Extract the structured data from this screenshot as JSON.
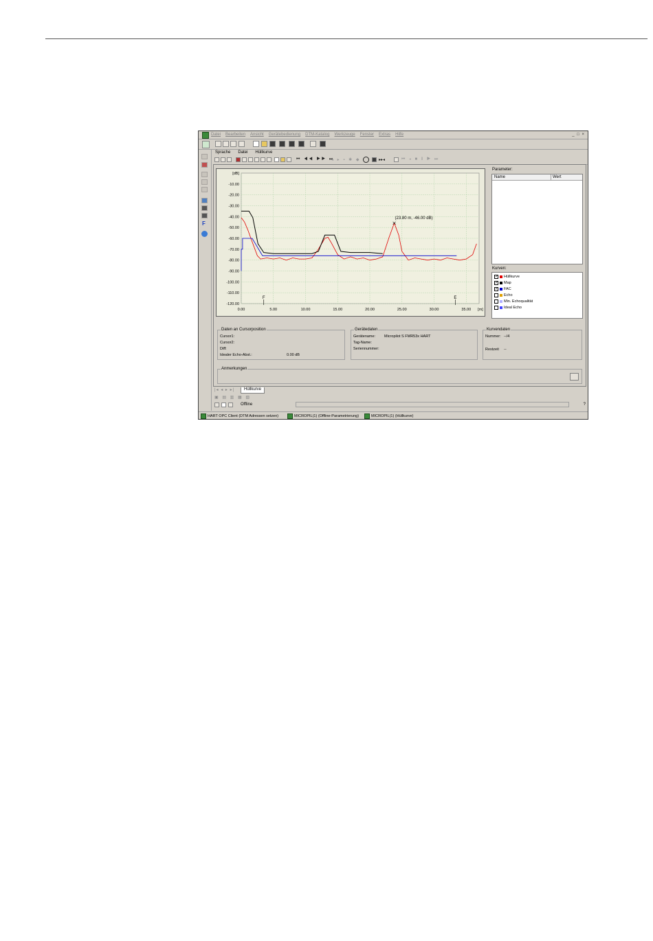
{
  "window": {
    "menu": [
      "Datei",
      "Bearbeiten",
      "Ansicht",
      "Gerätebedienung",
      "DTM-Katalog",
      "Werkzeuge",
      "Fenster",
      "Extras",
      "Hilfe"
    ],
    "controls": "_ □ ×"
  },
  "submenu": [
    "Sprache",
    "Datei",
    "Hüllkurve"
  ],
  "plot": {
    "help": "?"
  },
  "parameter": {
    "label": "Parameter:",
    "col_name": "Name",
    "col_value": "Wert"
  },
  "kurven": {
    "label": "Kurven:",
    "items": [
      {
        "label": "Hüllkurve",
        "checked": true,
        "color": "#e00000"
      },
      {
        "label": "Map",
        "checked": true,
        "color": "#000000"
      },
      {
        "label": "FAC",
        "checked": true,
        "color": "#0000cc"
      },
      {
        "label": "Echo",
        "checked": false,
        "color": "#e0a000"
      },
      {
        "label": "Min. Echoqualität",
        "checked": false,
        "color": "#b0b0ff"
      },
      {
        "label": "Ideal Echo",
        "checked": false,
        "color": "#4040ff"
      }
    ]
  },
  "cursor_group": {
    "title": "Daten an Cursorposition",
    "cursor1": "Cursor1:",
    "cursor2": "Cursor2:",
    "diff": "Diff:",
    "ideal_label": "Idealer Echo-Abst.:",
    "ideal_value": "0.00 dB"
  },
  "device_group": {
    "title": "Gerätedaten",
    "name_label": "Gerätename:",
    "name_value": "Micropilot S FMR53x HART",
    "tag_label": "Tag-Name:",
    "serial_label": "Seriennummer:"
  },
  "curve_group": {
    "title": "Kurvendaten",
    "number_label": "Nummer:",
    "number_value": "--/4",
    "rest_label": "Restzeit",
    "rest_value": "--"
  },
  "notes": {
    "title": "Anmerkungen"
  },
  "tab": {
    "label": "Hüllkurve"
  },
  "status": {
    "text": "Offline",
    "help": "?"
  },
  "taskbar": [
    "HART OPC Client (DTM Adressen setzen)",
    "MICROPIL(1) (Offline-Parametrierung)",
    "MICROPIL(1) (Hüllkurve)"
  ],
  "chart_data": {
    "type": "line",
    "ylabel": "[dB]",
    "xlabel": "[m]",
    "xlim": [
      0,
      37
    ],
    "ylim": [
      -120,
      0
    ],
    "xticks": [
      "0.00",
      "5.00",
      "10.00",
      "15.00",
      "20.00",
      "25.00",
      "30.00",
      "35.00"
    ],
    "yticks": [
      "-10.00",
      "-20.00",
      "-30.00",
      "-40.00",
      "-50.00",
      "-60.00",
      "-70.00",
      "-80.00",
      "-90.00",
      "-100.00",
      "-110.00",
      "-120.00"
    ],
    "grid": true,
    "markers": [
      {
        "label": "F",
        "x": 3.5
      },
      {
        "label": "E",
        "x": 33.3
      }
    ],
    "annotation": {
      "text": "(23.80 m, -46.00 dB)",
      "x": 23.8,
      "y": -46
    },
    "series": [
      {
        "name": "Hüllkurve",
        "color": "#e00000",
        "points": [
          [
            0,
            -41
          ],
          [
            0.5,
            -45
          ],
          [
            1,
            -52
          ],
          [
            1.5,
            -60
          ],
          [
            2,
            -68
          ],
          [
            2.5,
            -76
          ],
          [
            3,
            -79
          ],
          [
            4,
            -78
          ],
          [
            5,
            -79
          ],
          [
            6,
            -78
          ],
          [
            7,
            -80
          ],
          [
            8,
            -78
          ],
          [
            9,
            -79
          ],
          [
            10,
            -79
          ],
          [
            11,
            -78
          ],
          [
            12,
            -70
          ],
          [
            13,
            -60
          ],
          [
            13.5,
            -59
          ],
          [
            14,
            -64
          ],
          [
            15,
            -75
          ],
          [
            16,
            -79
          ],
          [
            17,
            -77
          ],
          [
            18,
            -79
          ],
          [
            19,
            -78
          ],
          [
            20,
            -80
          ],
          [
            21,
            -79
          ],
          [
            22,
            -77
          ],
          [
            23,
            -59
          ],
          [
            23.8,
            -46
          ],
          [
            24.5,
            -57
          ],
          [
            25,
            -72
          ],
          [
            26,
            -80
          ],
          [
            27,
            -78
          ],
          [
            28,
            -79
          ],
          [
            29,
            -80
          ],
          [
            30,
            -79
          ],
          [
            31,
            -80
          ],
          [
            32,
            -78
          ],
          [
            33,
            -79
          ],
          [
            34,
            -80
          ],
          [
            35,
            -79
          ],
          [
            36,
            -75
          ],
          [
            36.6,
            -65
          ]
        ]
      },
      {
        "name": "Map",
        "color": "#000000",
        "points": [
          [
            0,
            -35
          ],
          [
            1.2,
            -35
          ],
          [
            1.8,
            -41
          ],
          [
            2.6,
            -65
          ],
          [
            3.5,
            -73
          ],
          [
            5,
            -74
          ],
          [
            8,
            -74
          ],
          [
            11,
            -74
          ],
          [
            12,
            -72
          ],
          [
            13,
            -57
          ],
          [
            14.5,
            -57
          ],
          [
            15.5,
            -72
          ],
          [
            17,
            -73
          ],
          [
            20,
            -73
          ],
          [
            22,
            -74
          ]
        ]
      },
      {
        "name": "FAC",
        "color": "#0000cc",
        "points": [
          [
            0,
            -90
          ],
          [
            0,
            -70
          ],
          [
            0.2,
            -70
          ],
          [
            0.2,
            -60
          ],
          [
            1.7,
            -60
          ],
          [
            3.3,
            -76
          ],
          [
            33.5,
            -76
          ]
        ]
      }
    ]
  }
}
